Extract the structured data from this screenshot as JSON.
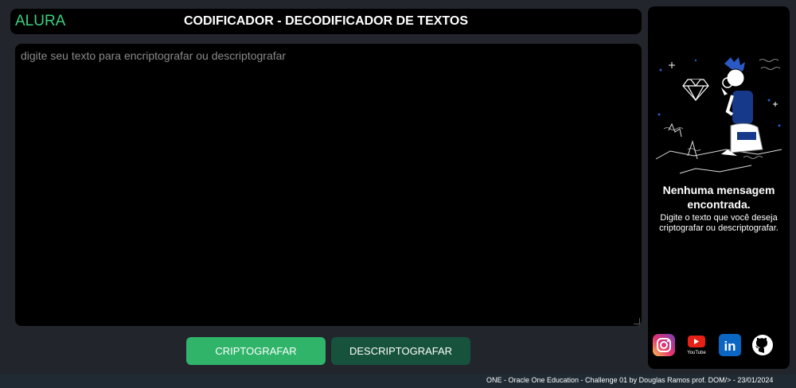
{
  "header": {
    "logo": "ALURA",
    "title": "CODIFICADOR - DECODIFICADOR DE TEXTOS"
  },
  "editor": {
    "value": "",
    "placeholder": "digite seu texto para encriptografar ou descriptografar"
  },
  "buttons": {
    "encrypt": "CRIPTOGRAFAR",
    "decrypt": "DESCRIPTOGRAFAR"
  },
  "side_panel": {
    "message_title": "Nenhuma mensagem encontrada.",
    "message_subtitle": "Digite o texto que você deseja criptografar ou descriptografar.",
    "illustration": "person-with-magnifier-and-diamond-illustration"
  },
  "socials": [
    {
      "name": "instagram-icon"
    },
    {
      "name": "youtube-icon",
      "label": "YouTube"
    },
    {
      "name": "linkedin-icon",
      "label": "in"
    },
    {
      "name": "github-icon"
    }
  ],
  "footer": {
    "text": "ONE - Oracle One Education - Challenge 01 by Douglas Ramos prof. DOM/> - 23/01/2024"
  },
  "colors": {
    "accent": "#3bcf7f",
    "encrypt_button": "#2fb46a",
    "decrypt_button": "#16523c",
    "background": "#22252c"
  }
}
